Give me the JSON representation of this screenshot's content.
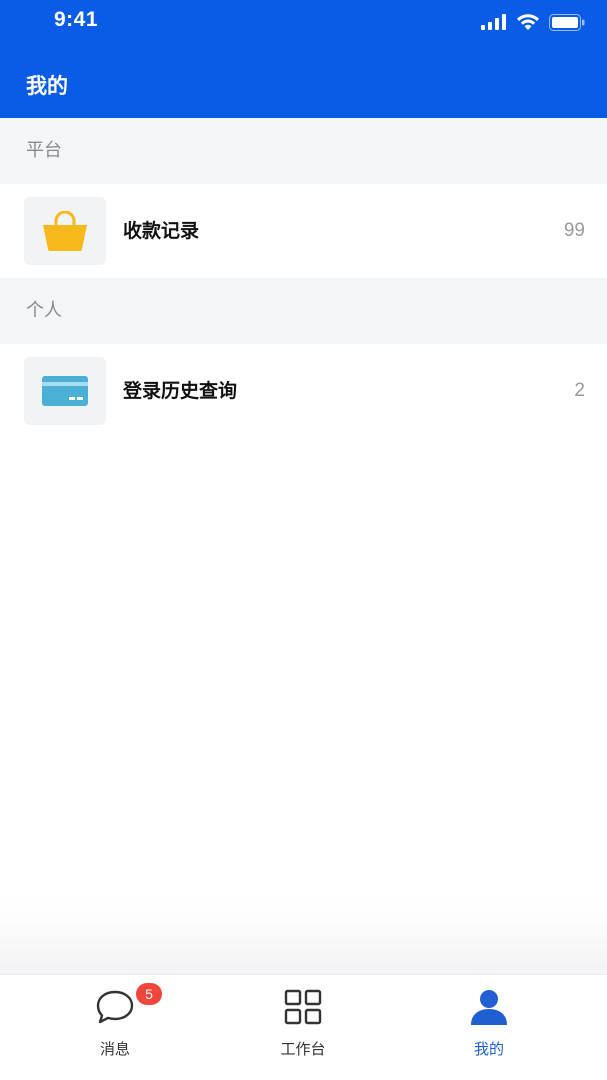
{
  "status_bar": {
    "time": "9:41"
  },
  "header": {
    "title": "我的"
  },
  "sections": [
    {
      "title": "平台",
      "items": [
        {
          "label": "收款记录",
          "count": "99",
          "icon": "shopping-bag-icon"
        }
      ]
    },
    {
      "title": "个人",
      "items": [
        {
          "label": "登录历史查询",
          "count": "2",
          "icon": "card-icon"
        }
      ]
    }
  ],
  "tabbar": {
    "tabs": [
      {
        "label": "消息",
        "icon": "chat-bubble-icon",
        "badge": "5"
      },
      {
        "label": "工作台",
        "icon": "grid-icon"
      },
      {
        "label": "我的",
        "icon": "user-icon",
        "active": true
      }
    ]
  },
  "colors": {
    "header_bg": "#0a5ce6",
    "section_bg": "#f4f5f7",
    "active_tab": "#1f5fd1",
    "badge": "#f0453a",
    "bag_icon": "#f7b81b",
    "card_icon": "#4bb0d8"
  }
}
